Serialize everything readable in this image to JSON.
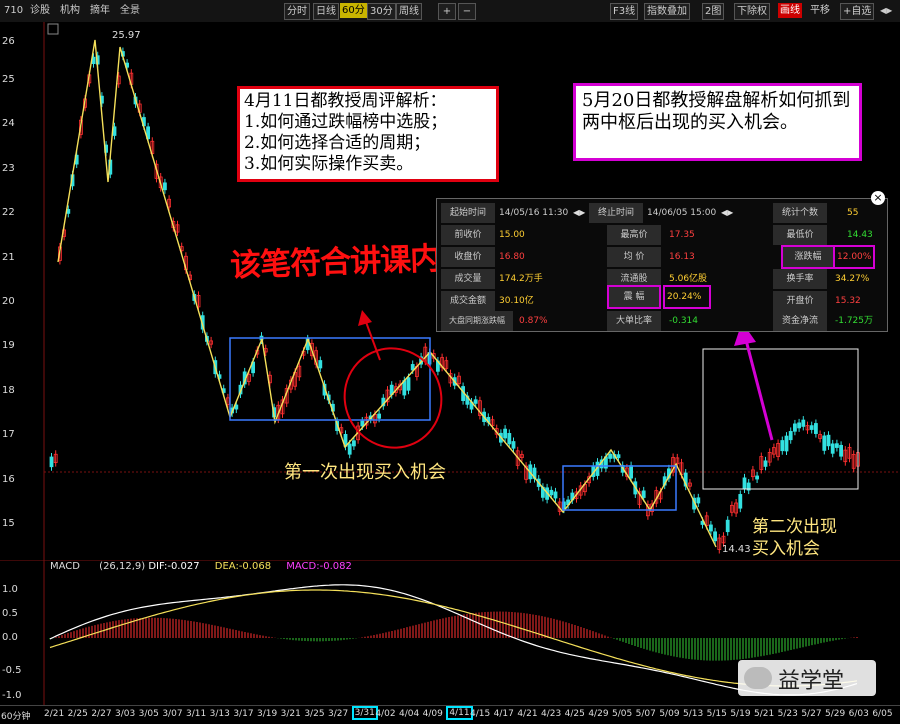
{
  "toolbar": {
    "code": "710",
    "left_items": [
      "诊股",
      "机构",
      "摘年",
      "全景"
    ],
    "periods": [
      "分时",
      "日线",
      "60分",
      "30分",
      "周线"
    ],
    "selected_period": "60分",
    "zoom_plus": "+",
    "zoom_minus": "−",
    "right_items": [
      "F3线",
      "指数叠加",
      "2图",
      "下除权",
      "画线",
      "平移",
      "+自选"
    ],
    "nav_icons": [
      "◀",
      "▶",
      "▲"
    ]
  },
  "price_axis": [
    "26",
    "25",
    "24",
    "23",
    "22",
    "21",
    "20",
    "19",
    "18",
    "17",
    "16",
    "15"
  ],
  "chart_labels": {
    "high": "25.97",
    "low": "14.43",
    "first_buy": "第一次出现买入机会",
    "second_buy_line1": "第二次出现",
    "second_buy_line2": "买入机会",
    "vertical_text": "该笔符合讲课内容"
  },
  "annotation_red": {
    "line1": "4月11日都教授周评解析：",
    "line2": "1.如何通过跌幅榜中选股；",
    "line3": "2.如何选择合适的周期；",
    "line4": "3.如何实际操作买卖。"
  },
  "annotation_magenta": {
    "text": "5月20日都教授解盘解析如何抓到两中枢后出现的买入机会。"
  },
  "info_panel": {
    "close_icon": "×",
    "start_label": "起始时间",
    "start_value": "14/05/16 11:30",
    "end_label": "终止时间",
    "end_value": "14/06/05 15:00",
    "count_label": "统计个数",
    "count_value": "55",
    "prev_close_label": "前收价",
    "prev_close_value": "15.00",
    "high_label": "最高价",
    "high_value": "17.35",
    "low_label": "最低价",
    "low_value": "14.43",
    "close_label": "收盘价",
    "close_value": "16.80",
    "avg_label": "均  价",
    "avg_value": "16.13",
    "chg_label": "涨跌幅",
    "chg_value": "12.00%",
    "vol_label": "成交量",
    "vol_value": "174.2万手",
    "float_label": "流通股",
    "float_value": "5.06亿股",
    "turnover_label": "换手率",
    "turnover_value": "34.27%",
    "amount_label": "成交金额",
    "amount_value": "30.10亿",
    "amp_label": "震  幅",
    "amp_value": "20.24%",
    "open_label": "开盘价",
    "open_value": "15.32",
    "index_label": "大盘同期涨跌幅",
    "index_value": "0.87%",
    "ratio_label": "大单比率",
    "ratio_value": "-0.314",
    "net_label": "资金净流",
    "net_value": "-1.725万"
  },
  "macd": {
    "title": "MACD",
    "params": "(26,12,9)",
    "dif": "DIF:-0.027",
    "dea": "DEA:-0.068",
    "macd": "MACD:-0.082",
    "axis": [
      "1.0",
      "0.5",
      "0.0",
      "-0.5",
      "-1.0"
    ]
  },
  "dates": {
    "period_label": "60分钟",
    "items": [
      "2/21",
      "2/25",
      "2/27",
      "3/03",
      "3/05",
      "3/07",
      "3/11",
      "3/13",
      "3/17",
      "3/19",
      "3/21",
      "3/25",
      "3/27",
      "3/31",
      "4/02",
      "4/04",
      "4/09",
      "4/11",
      "4/15",
      "4/17",
      "4/21",
      "4/23",
      "4/25",
      "4/29",
      "5/05",
      "5/07",
      "5/09",
      "5/13",
      "5/15",
      "5/19",
      "5/21",
      "5/23",
      "5/27",
      "5/29",
      "6/03",
      "6/05"
    ],
    "highlighted": [
      "3/31",
      "4/11"
    ]
  },
  "watermark": "益学堂"
}
